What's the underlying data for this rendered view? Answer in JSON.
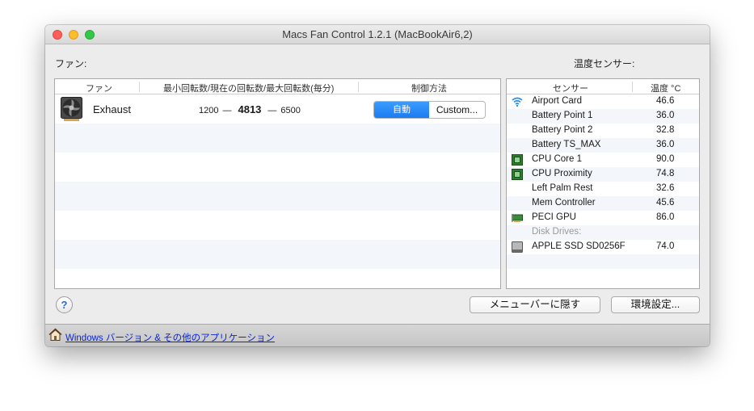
{
  "window": {
    "title": "Macs Fan Control 1.2.1 (MacBookAir6,2)"
  },
  "labels": {
    "fans": "ファン:",
    "temps": "温度センサー:"
  },
  "fan_table": {
    "columns": [
      "ファン",
      "最小回転数/現在の回転数/最大回転数(毎分)",
      "制御方法"
    ],
    "rows": [
      {
        "name": "Exhaust",
        "min": "1200",
        "current": "4813",
        "max": "6500",
        "dash": "—",
        "control_auto": "自動",
        "control_custom": "Custom..."
      }
    ]
  },
  "sensor_table": {
    "columns": [
      "センサー",
      "温度 °C"
    ],
    "rows": [
      {
        "icon": "wifi-icon",
        "name": "Airport Card",
        "value": "46.6"
      },
      {
        "icon": "",
        "name": "Battery Point 1",
        "value": "36.0"
      },
      {
        "icon": "",
        "name": "Battery Point 2",
        "value": "32.8"
      },
      {
        "icon": "",
        "name": "Battery TS_MAX",
        "value": "36.0"
      },
      {
        "icon": "cpu-chip-icon",
        "name": "CPU Core 1",
        "value": "90.0"
      },
      {
        "icon": "cpu-chip-icon",
        "name": "CPU Proximity",
        "value": "74.8"
      },
      {
        "icon": "",
        "name": "Left Palm Rest",
        "value": "32.6"
      },
      {
        "icon": "",
        "name": "Mem Controller",
        "value": "45.6"
      },
      {
        "icon": "gpu-card-icon",
        "name": "PECI GPU",
        "value": "86.0"
      },
      {
        "group": "Disk Drives:"
      },
      {
        "icon": "disk-drive-icon",
        "name": "APPLE SSD SD0256F",
        "value": "74.0"
      }
    ]
  },
  "buttons": {
    "help": "?",
    "hide_to_menu": "メニューバーに隠す",
    "preferences": "環境設定..."
  },
  "footer": {
    "link": "Windows バージョン & その他のアプリケーション",
    "icon": "home-icon"
  },
  "colors": {
    "accent": "#1d7cf0",
    "link": "#0b26d8",
    "stripe": "#f3f6fa"
  }
}
